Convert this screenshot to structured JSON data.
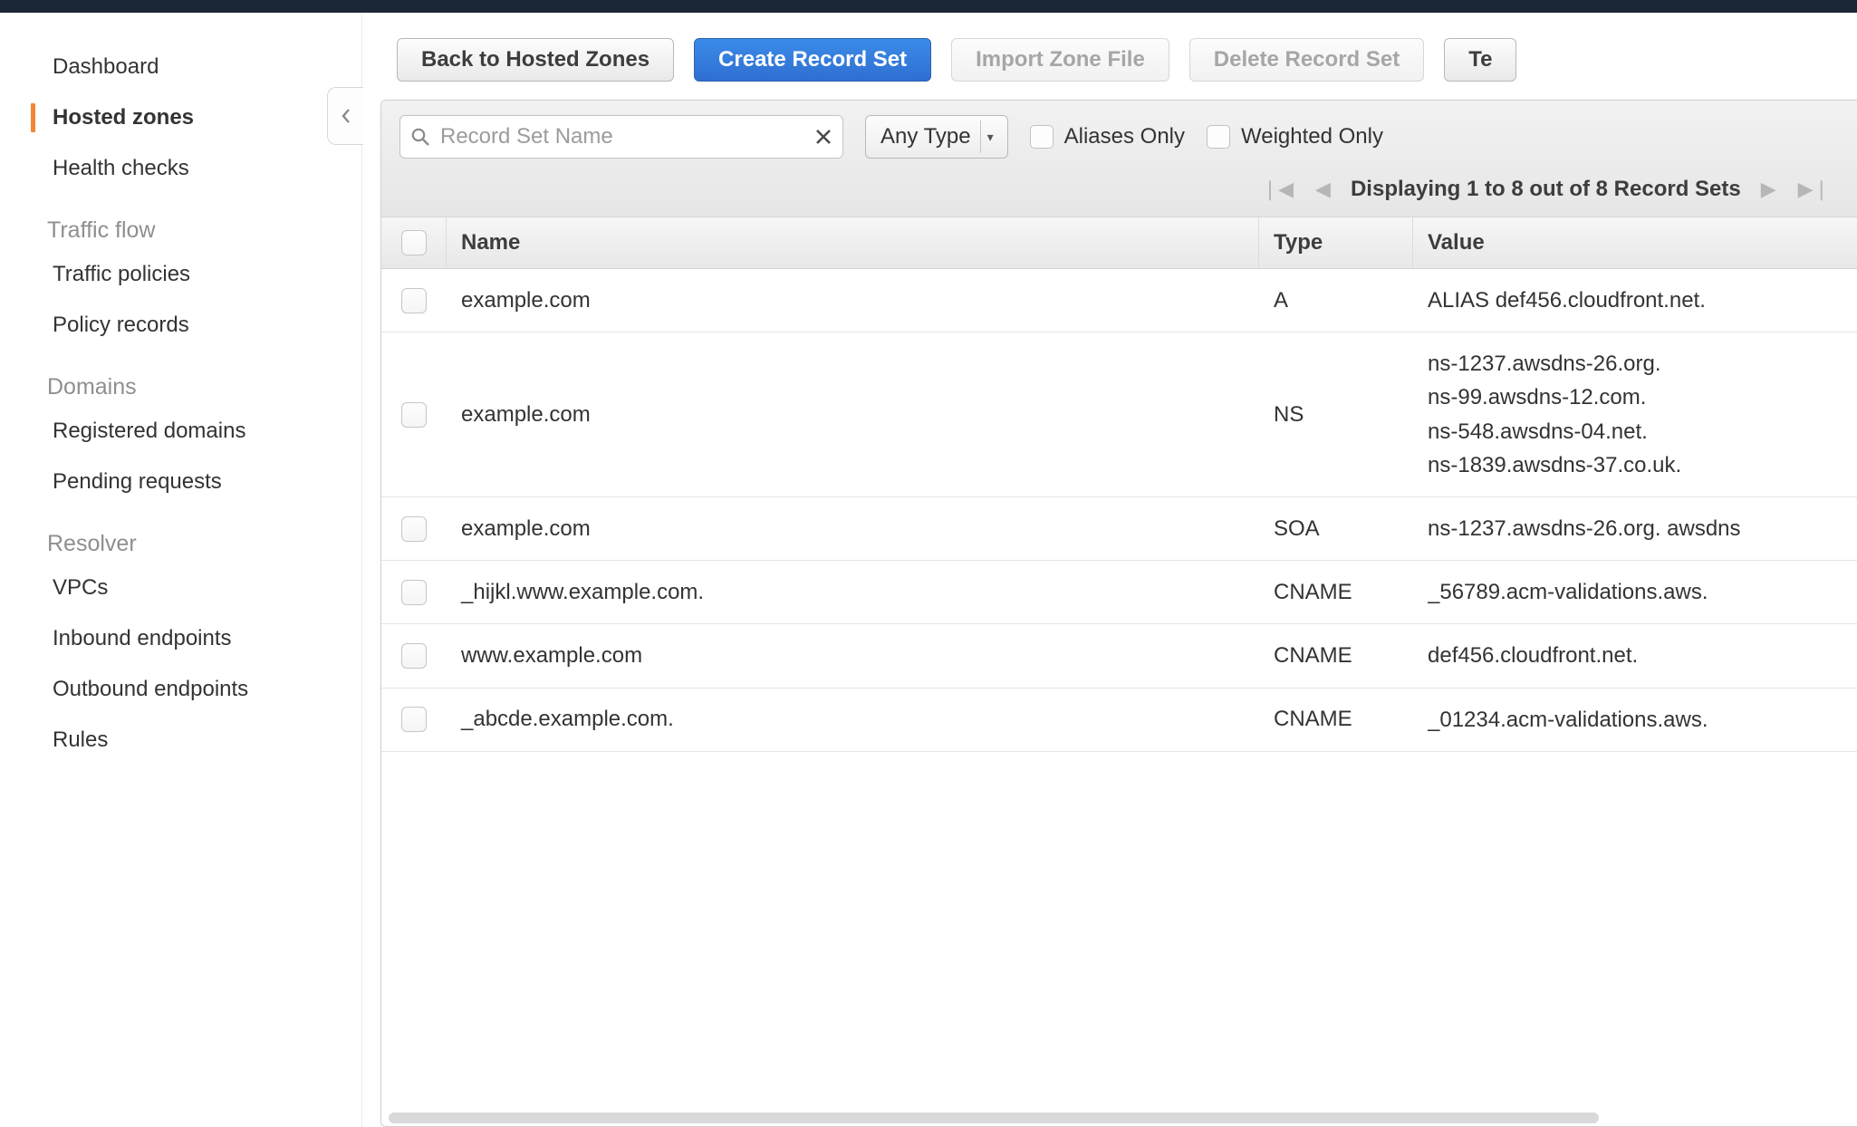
{
  "sidebar": {
    "items": [
      {
        "label": "Dashboard"
      },
      {
        "label": "Hosted zones",
        "active": true
      },
      {
        "label": "Health checks"
      }
    ],
    "groups": [
      {
        "title": "Traffic flow",
        "items": [
          "Traffic policies",
          "Policy records"
        ]
      },
      {
        "title": "Domains",
        "items": [
          "Registered domains",
          "Pending requests"
        ]
      },
      {
        "title": "Resolver",
        "items": [
          "VPCs",
          "Inbound endpoints",
          "Outbound endpoints",
          "Rules"
        ]
      }
    ]
  },
  "toolbar": {
    "back": "Back to Hosted Zones",
    "create": "Create Record Set",
    "import": "Import Zone File",
    "delete": "Delete Record Set",
    "test": "Te"
  },
  "filters": {
    "search_placeholder": "Record Set Name",
    "type_label": "Any Type",
    "aliases_label": "Aliases Only",
    "weighted_label": "Weighted Only",
    "pagination_text": "Displaying 1 to 8 out of 8 Record Sets"
  },
  "table": {
    "headers": {
      "name": "Name",
      "type": "Type",
      "value": "Value"
    },
    "rows": [
      {
        "name": "example.com",
        "type": "A",
        "values": [
          "ALIAS def456.cloudfront.net."
        ]
      },
      {
        "name": "example.com",
        "type": "NS",
        "values": [
          "ns-1237.awsdns-26.org.",
          "ns-99.awsdns-12.com.",
          "ns-548.awsdns-04.net.",
          "ns-1839.awsdns-37.co.uk."
        ]
      },
      {
        "name": "example.com",
        "type": "SOA",
        "values": [
          "ns-1237.awsdns-26.org. awsdns"
        ]
      },
      {
        "name": "_hijkl.www.example.com.",
        "type": "CNAME",
        "values": [
          "_56789.acm-validations.aws."
        ]
      },
      {
        "name": "www.example.com",
        "type": "CNAME",
        "values": [
          "def456.cloudfront.net."
        ]
      },
      {
        "name": "_abcde.example.com.",
        "type": "CNAME",
        "values": [
          "_01234.acm-validations.aws."
        ]
      }
    ]
  }
}
